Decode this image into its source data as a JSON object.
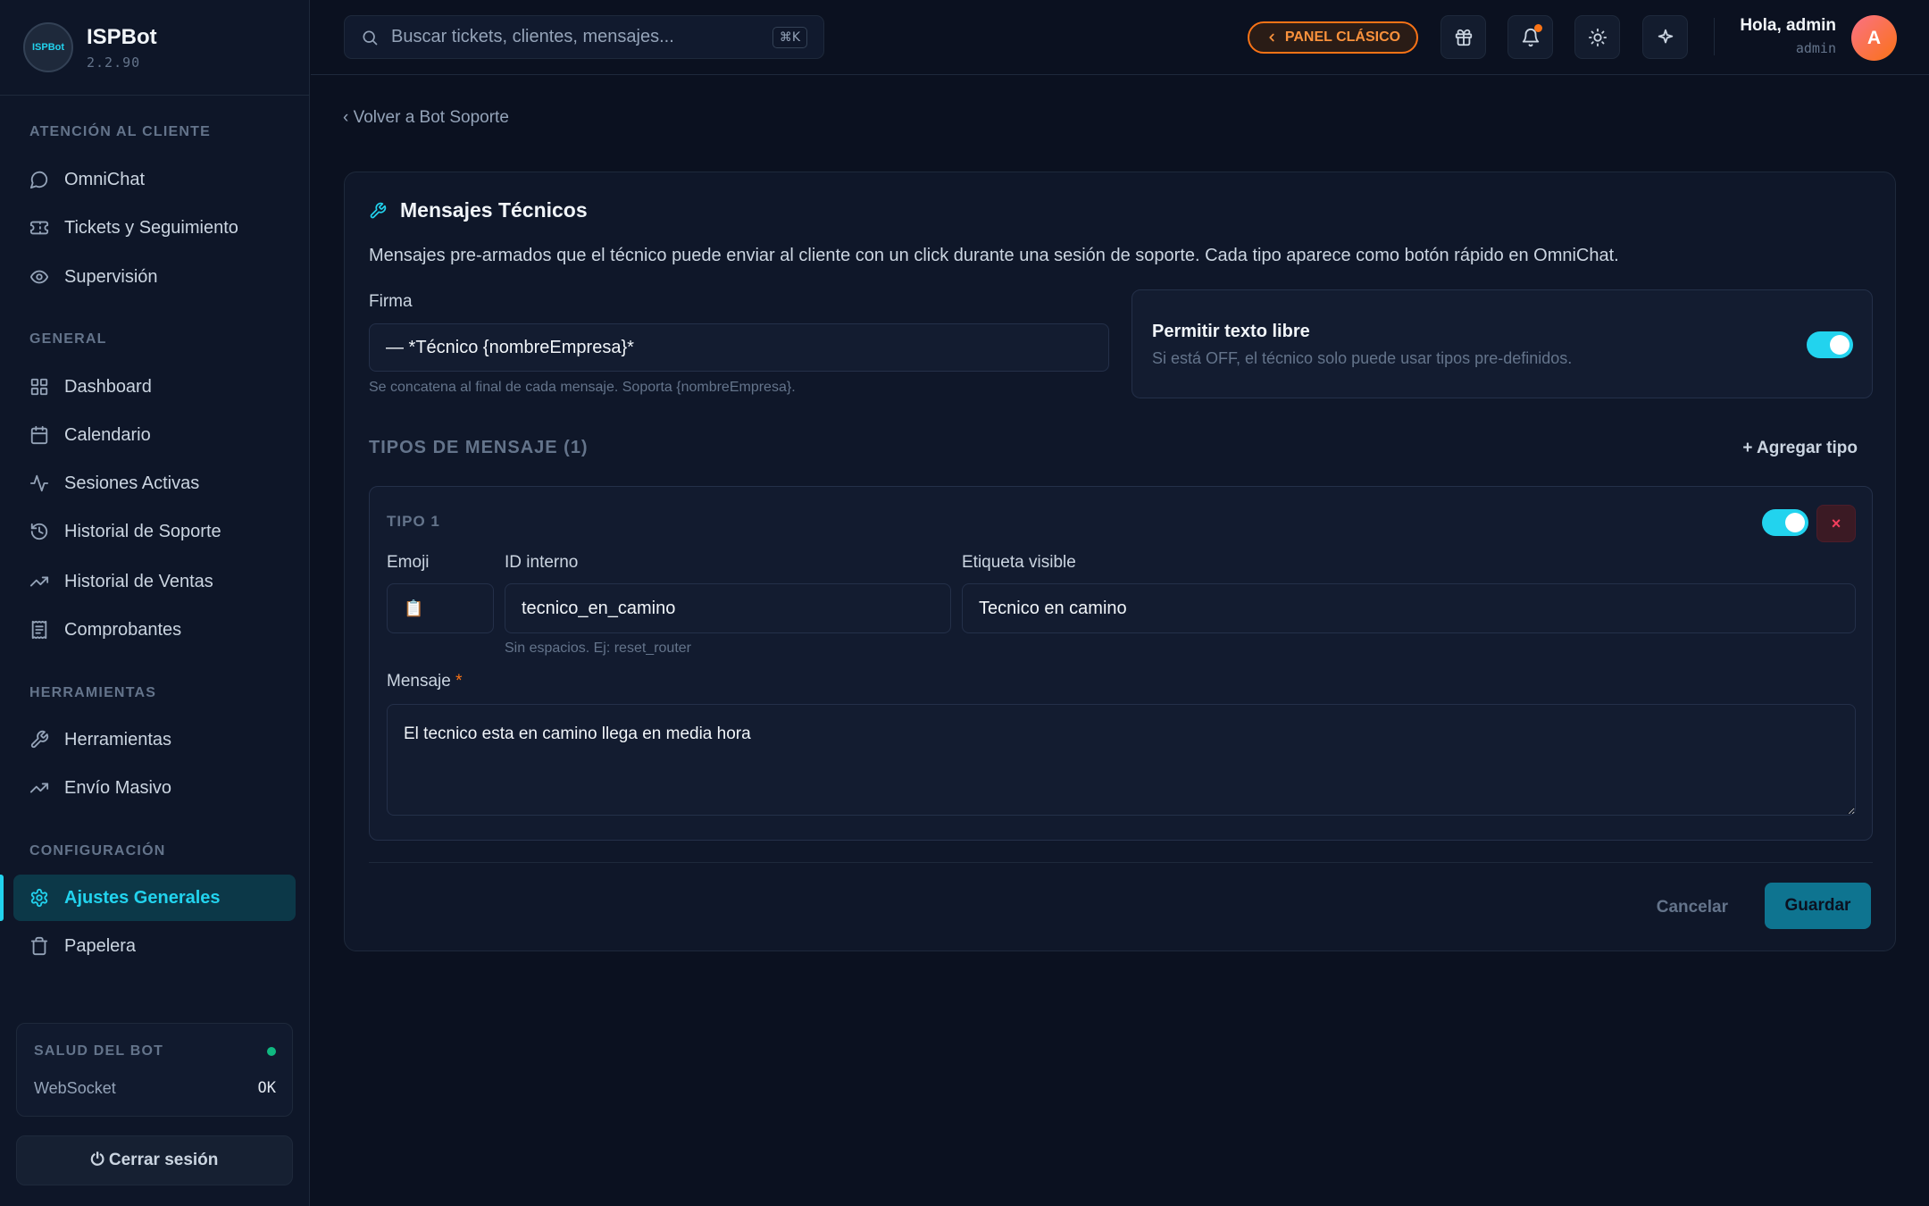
{
  "brand": {
    "name": "ISPBot",
    "version": "2.2.90",
    "logo_text": "ISPBot"
  },
  "sidebar": {
    "sections": [
      {
        "label": "ATENCIÓN AL CLIENTE"
      },
      {
        "label": "GENERAL"
      },
      {
        "label": "HERRAMIENTAS"
      },
      {
        "label": "CONFIGURACIÓN"
      }
    ],
    "items": [
      {
        "label": "OmniChat",
        "icon": "chat-bubble-icon"
      },
      {
        "label": "Tickets y Seguimiento",
        "icon": "ticket-icon"
      },
      {
        "label": "Supervisión",
        "icon": "eye-icon"
      },
      {
        "label": "Dashboard",
        "icon": "grid-icon"
      },
      {
        "label": "Calendario",
        "icon": "calendar-icon"
      },
      {
        "label": "Sesiones Activas",
        "icon": "activity-icon"
      },
      {
        "label": "Historial de Soporte",
        "icon": "history-icon"
      },
      {
        "label": "Historial de Ventas",
        "icon": "trending-up-icon"
      },
      {
        "label": "Comprobantes",
        "icon": "receipt-icon"
      },
      {
        "label": "Herramientas",
        "icon": "wrench-icon"
      },
      {
        "label": "Envío Masivo",
        "icon": "trending-up-icon"
      },
      {
        "label": "Ajustes Generales",
        "icon": "gear-icon",
        "active": true
      },
      {
        "label": "Papelera",
        "icon": "trash-icon"
      }
    ],
    "health": {
      "title": "SALUD DEL BOT",
      "label": "WebSocket",
      "value": "OK",
      "status_color": "#10b981"
    },
    "logout_label": "⏻ Cerrar sesión"
  },
  "topbar": {
    "search_placeholder": "Buscar tickets, clientes, mensajes...",
    "shortcut": "⌘K",
    "classic_panel_label": "PANEL CLÁSICO",
    "greeting": "Hola, admin",
    "role": "admin",
    "avatar_initial": "A"
  },
  "main": {
    "back_link": "‹ Volver a Bot Soporte",
    "title": "Mensajes Técnicos",
    "description": "Mensajes pre-armados que el técnico puede enviar al cliente con un click durante una sesión de soporte. Cada tipo aparece como botón rápido en OmniChat.",
    "signature": {
      "label": "Firma",
      "value": "— *Técnico {nombreEmpresa}*",
      "hint": "Se concatena al final de cada mensaje. Soporta {nombreEmpresa}."
    },
    "free_text": {
      "title": "Permitir texto libre",
      "subtitle": "Si está OFF, el técnico solo puede usar tipos pre-definidos.",
      "enabled": true
    },
    "types_header": "TIPOS DE MENSAJE (1)",
    "add_type_label": "+ Agregar tipo",
    "types": [
      {
        "label": "TIPO 1",
        "enabled": true,
        "delete_label": "×",
        "emoji_label": "Emoji",
        "emoji": "📋",
        "id_label": "ID interno",
        "id_value": "tecnico_en_camino",
        "id_hint": "Sin espacios. Ej: reset_router",
        "visible_label": "Etiqueta visible",
        "visible_value": "Tecnico en camino",
        "message_label": "Mensaje",
        "required_mark": "*",
        "message_value": "El tecnico esta en camino llega en media hora"
      }
    ],
    "cancel_label": "Cancelar",
    "save_label": "Guardar"
  },
  "colors": {
    "accent": "#22d3ee",
    "background": "#0b1120",
    "warning": "#f97316",
    "danger": "#f43f5e"
  }
}
